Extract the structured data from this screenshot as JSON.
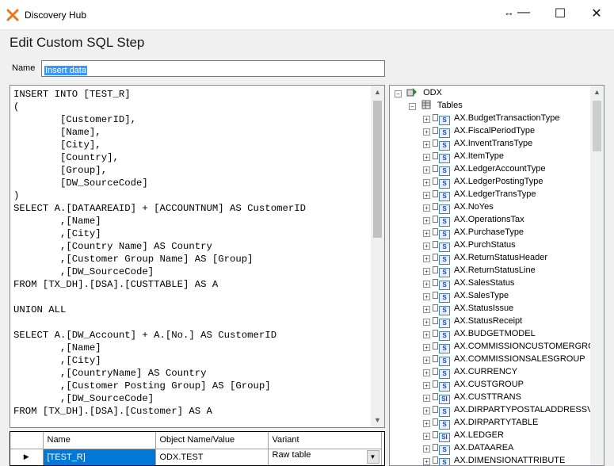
{
  "window": {
    "title": "Discovery Hub",
    "resize_glyph": "↔",
    "minimize_glyph": "—",
    "maximize_glyph": "☐",
    "close_glyph": "✕",
    "app_icon": "x-logo-icon",
    "accent": "#e8761c"
  },
  "dialog": {
    "heading": "Edit Custom SQL Step",
    "name_label": "Name",
    "name_value": "Insert data"
  },
  "sql_text": "INSERT INTO [TEST_R]\n(\n        [CustomerID],\n        [Name],\n        [City],\n        [Country],\n        [Group],\n        [DW_SourceCode]\n)\nSELECT A.[DATAAREAID] + [ACCOUNTNUM] AS CustomerID\n        ,[Name]\n        ,[City]\n        ,[Country Name] AS Country\n        ,[Customer Group Name] AS [Group]\n        ,[DW_SourceCode]\nFROM [TX_DH].[DSA].[CUSTTABLE] AS A\n\nUNION ALL\n\nSELECT A.[DW_Account] + A.[No.] AS CustomerID\n        ,[Name]\n        ,[City]\n        ,[CountryName] AS Country\n        ,[Customer Posting Group] AS [Group]\n        ,[DW_SourceCode]\nFROM [TX_DH].[DSA].[Customer] AS A",
  "grid": {
    "columns": [
      "Name",
      "Object Name/Value",
      "Variant"
    ],
    "row": {
      "indicator": "▶",
      "name": "[TEST_R]",
      "object_value": "ODX.TEST",
      "variant": "Raw table",
      "dropdown_glyph": "▼"
    }
  },
  "tree": {
    "root": "ODX",
    "tables_node": "Tables",
    "expander_glyph": "+",
    "collapse_glyph": "−",
    "items": [
      {
        "label": "AX.BudgetTransactionType",
        "icon": "S"
      },
      {
        "label": "AX.FiscalPeriodType",
        "icon": "S"
      },
      {
        "label": "AX.InventTransType",
        "icon": "S"
      },
      {
        "label": "AX.ItemType",
        "icon": "S"
      },
      {
        "label": "AX.LedgerAccountType",
        "icon": "S"
      },
      {
        "label": "AX.LedgerPostingType",
        "icon": "S"
      },
      {
        "label": "AX.LedgerTransType",
        "icon": "S"
      },
      {
        "label": "AX.NoYes",
        "icon": "S"
      },
      {
        "label": "AX.OperationsTax",
        "icon": "S"
      },
      {
        "label": "AX.PurchaseType",
        "icon": "S"
      },
      {
        "label": "AX.PurchStatus",
        "icon": "S"
      },
      {
        "label": "AX.ReturnStatusHeader",
        "icon": "S"
      },
      {
        "label": "AX.ReturnStatusLine",
        "icon": "S"
      },
      {
        "label": "AX.SalesStatus",
        "icon": "S"
      },
      {
        "label": "AX.SalesType",
        "icon": "S"
      },
      {
        "label": "AX.StatusIssue",
        "icon": "S"
      },
      {
        "label": "AX.StatusReceipt",
        "icon": "S"
      },
      {
        "label": "AX.BUDGETMODEL",
        "icon": "S"
      },
      {
        "label": "AX.COMMISSIONCUSTOMERGRO",
        "icon": "S"
      },
      {
        "label": "AX.COMMISSIONSALESGROUP",
        "icon": "S"
      },
      {
        "label": "AX.CURRENCY",
        "icon": "S"
      },
      {
        "label": "AX.CUSTGROUP",
        "icon": "S"
      },
      {
        "label": "AX.CUSTTRANS",
        "icon": "SI"
      },
      {
        "label": "AX.DIRPARTYPOSTALADDRESSV",
        "icon": "S"
      },
      {
        "label": "AX.DIRPARTYTABLE",
        "icon": "S"
      },
      {
        "label": "AX.LEDGER",
        "icon": "SI"
      },
      {
        "label": "AX.DATAAREA",
        "icon": "S"
      },
      {
        "label": "AX.DIMENSIONATTRIBUTE",
        "icon": "S"
      }
    ]
  },
  "scroll": {
    "up_glyph": "▲",
    "down_glyph": "▼"
  }
}
